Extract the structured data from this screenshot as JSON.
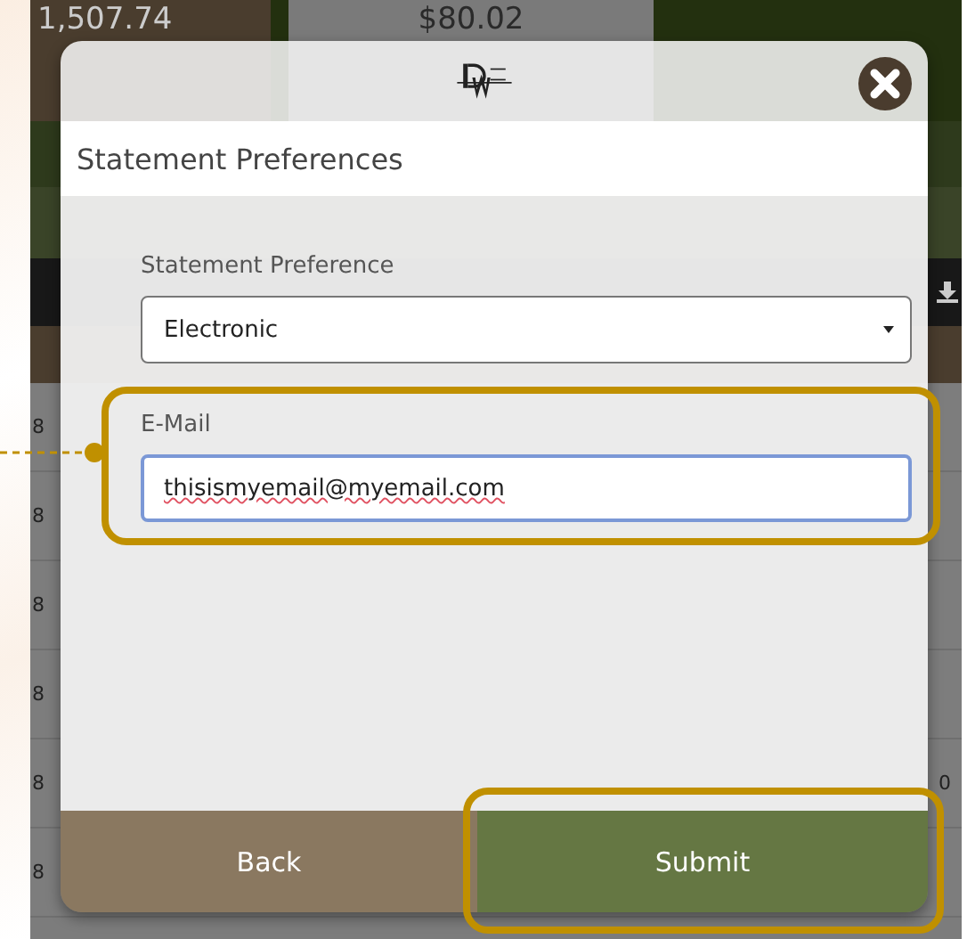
{
  "background": {
    "balances": [
      {
        "amount": "1,507.74"
      },
      {
        "amount": "$80.02"
      }
    ],
    "rows": [
      {
        "date": "8"
      },
      {
        "date": "8"
      },
      {
        "date": "8"
      },
      {
        "date": "8"
      },
      {
        "date": "8",
        "amount": "0"
      },
      {
        "date": "8"
      }
    ]
  },
  "dialog": {
    "title": "Statement Preferences",
    "fields": [
      {
        "kind": "select",
        "label": "Statement Preference",
        "value": "Electronic",
        "focused": false,
        "highlighted": false
      },
      {
        "kind": "input",
        "label": "E-Mail",
        "value": "thisismyemail@myemail.com",
        "focused": true,
        "highlighted": true,
        "pointer": true
      }
    ],
    "buttons": [
      {
        "kind": "back",
        "label": "Back",
        "highlighted": false
      },
      {
        "kind": "submit",
        "label": "Submit",
        "highlighted": true
      }
    ]
  }
}
